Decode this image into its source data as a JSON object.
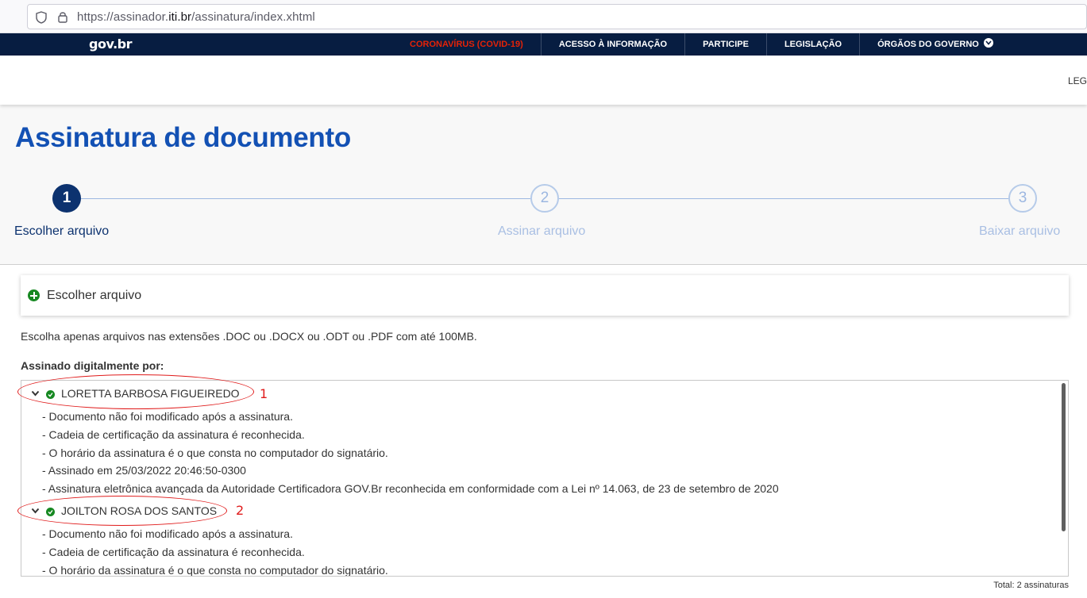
{
  "browser": {
    "url_prefix": "https://assinador.",
    "url_domain": "iti.br",
    "url_suffix": "/assinatura/index.xhtml"
  },
  "gov_bar": {
    "logo": "gov.br",
    "links": [
      {
        "label": "CORONAVÍRUS (COVID-19)",
        "highlight": true
      },
      {
        "label": "ACESSO À INFORMAÇÃO"
      },
      {
        "label": "PARTICIPE"
      },
      {
        "label": "LEGISLAÇÃO"
      },
      {
        "label": "ÓRGÃOS DO GOVERNO",
        "dropdown": true
      }
    ],
    "colors": {
      "background": "#071d41",
      "covid": "#e52207"
    }
  },
  "header": {
    "cut_text": "LEG"
  },
  "page": {
    "title": "Assinatura de documento"
  },
  "stepper": {
    "steps": [
      {
        "number": "1",
        "label": "Escolher arquivo",
        "state": "active"
      },
      {
        "number": "2",
        "label": "Assinar arquivo",
        "state": "inactive"
      },
      {
        "number": "3",
        "label": "Baixar arquivo",
        "state": "inactive"
      }
    ]
  },
  "file_panel": {
    "label": "Escolher arquivo",
    "icon": "plus-circle-icon"
  },
  "hint": "Escolha apenas arquivos nas extensões .DOC ou .DOCX ou .ODT ou .PDF com até 100MB.",
  "signatures": {
    "heading": "Assinado digitalmente por:",
    "signers": [
      {
        "name": "LORETTA BARBOSA FIGUEIREDO",
        "annotation": "1",
        "details": [
          "- Documento não foi modificado após a assinatura.",
          "- Cadeia de certificação da assinatura é reconhecida.",
          "- O horário da assinatura é o que consta no computador do signatário.",
          "- Assinado em 25/03/2022 20:46:50-0300",
          "- Assinatura eletrônica avançada da Autoridade Certificadora GOV.Br reconhecida em conformidade com a Lei nº 14.063, de 23 de setembro de 2020"
        ]
      },
      {
        "name": "JOILTON ROSA DOS SANTOS",
        "annotation": "2",
        "details": [
          "- Documento não foi modificado após a assinatura.",
          "- Cadeia de certificação da assinatura é reconhecida.",
          "- O horário da assinatura é o que consta no computador do signatário."
        ]
      }
    ],
    "total": "Total: 2 assinaturas"
  },
  "accent_colors": {
    "primary": "#1351b4",
    "dark": "#0c326f",
    "success": "#168821",
    "annotation": "#e01b1b"
  }
}
